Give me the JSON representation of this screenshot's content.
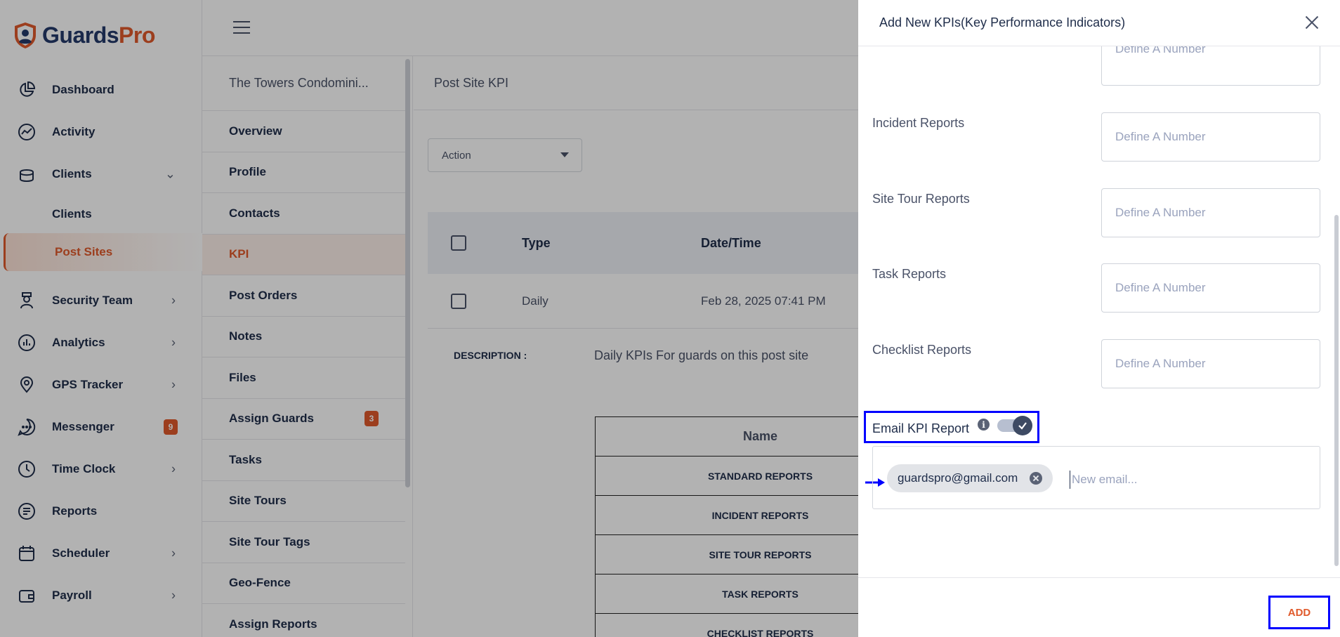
{
  "brand": {
    "name_part1": "Guards",
    "name_part2": "Pro"
  },
  "nav": [
    {
      "label": "Dashboard",
      "icon": "pie-chart-icon",
      "chevron": false
    },
    {
      "label": "Activity",
      "icon": "activity-icon",
      "chevron": false
    },
    {
      "label": "Clients",
      "icon": "clients-icon",
      "chevron": "down"
    },
    {
      "label": "Security Team",
      "icon": "guard-icon",
      "chevron": "right"
    },
    {
      "label": "Analytics",
      "icon": "analytics-icon",
      "chevron": "right"
    },
    {
      "label": "GPS Tracker",
      "icon": "location-pin-icon",
      "chevron": "right"
    },
    {
      "label": "Messenger",
      "icon": "chat-icon",
      "badge": "9"
    },
    {
      "label": "Time Clock",
      "icon": "clock-icon",
      "chevron": "right"
    },
    {
      "label": "Reports",
      "icon": "reports-icon",
      "chevron": false
    },
    {
      "label": "Scheduler",
      "icon": "calendar-icon",
      "chevron": "right"
    },
    {
      "label": "Payroll",
      "icon": "wallet-icon",
      "chevron": "right"
    }
  ],
  "nav_sub": {
    "clients": "Clients",
    "post_sites": "Post Sites"
  },
  "submenu": {
    "title": "The Towers Condomini...",
    "items": [
      "Overview",
      "Profile",
      "Contacts",
      "KPI",
      "Post Orders",
      "Notes",
      "Files",
      "Assign Guards",
      "Tasks",
      "Site Tours",
      "Site Tour Tags",
      "Geo-Fence",
      "Assign Reports"
    ],
    "assign_guards_badge": "3"
  },
  "main": {
    "heading": "Post Site KPI",
    "action_label": "Action",
    "table": {
      "headers": [
        "Type",
        "Date/Time"
      ],
      "rows": [
        {
          "type": "Daily",
          "datetime": "Feb 28, 2025 07:41 PM"
        }
      ]
    },
    "description_label": "DESCRIPTION :",
    "description_value": "Daily KPIs For guards on this post site",
    "kpi_table": {
      "header": "Name",
      "rows": [
        "STANDARD REPORTS",
        "INCIDENT REPORTS",
        "SITE TOUR REPORTS",
        "TASK REPORTS",
        "CHECKLIST REPORTS"
      ]
    }
  },
  "drawer": {
    "title": "Add New KPIs(Key Performance Indicators)",
    "placeholder": "Define A Number",
    "fields": [
      "Incident Reports",
      "Site Tour Reports",
      "Task Reports",
      "Checklist Reports"
    ],
    "email_kpi_label": "Email KPI Report",
    "email_toggle_on": true,
    "email_chip": "guardspro@gmail.com",
    "new_email_placeholder": "New email...",
    "add_label": "ADD"
  },
  "colors": {
    "brand_orange": "#e05a2b",
    "brand_navy": "#243a6b",
    "highlight": "#0000ff"
  }
}
